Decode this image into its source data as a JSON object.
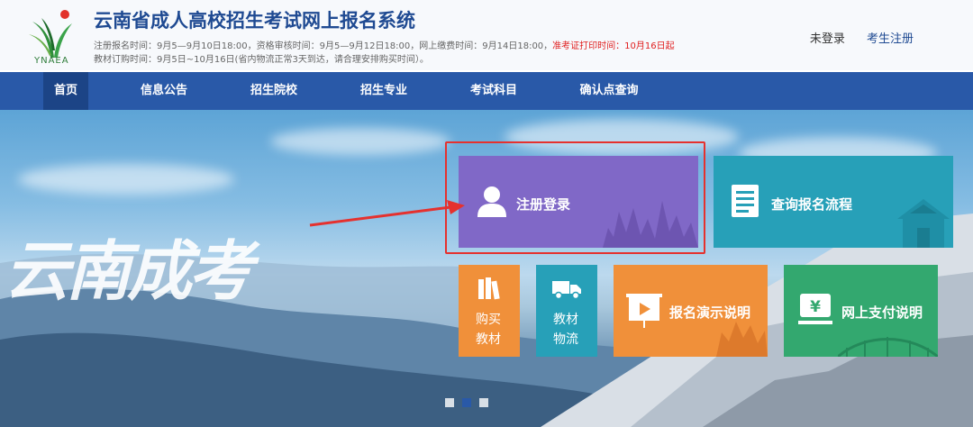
{
  "header": {
    "logo_text": "YNAEA",
    "title": "云南省成人高校招生考试网上报名系统",
    "info_line1_normal": "注册报名时间：9月5—9月10日18:00，资格审核时间：9月5—9月12日18:00，网上缴费时间：9月14日18:00，",
    "info_line1_highlight": "准考证打印时间：10月16日起",
    "info_line2": "教材订购时间：9月5日~10月16日(省内物流正常3天到达，请合理安排购买时间）。",
    "login_status": "未登录",
    "register_link": "考生注册"
  },
  "nav": {
    "items": [
      {
        "label": "首页",
        "active": true
      },
      {
        "label": "信息公告"
      },
      {
        "label": "招生院校"
      },
      {
        "label": "招生专业"
      },
      {
        "label": "考试科目"
      },
      {
        "label": "确认点查询"
      }
    ]
  },
  "hero": {
    "slogan": "云南成考"
  },
  "tiles": {
    "register_login": "注册登录",
    "query_process": "查询报名流程",
    "buy_books_l1": "购买",
    "buy_books_l2": "教材",
    "book_logistics_l1": "教材",
    "book_logistics_l2": "物流",
    "demo_guide": "报名演示说明",
    "payment_guide": "网上支付说明",
    "yen_symbol": "¥"
  },
  "colors": {
    "nav_bg": "#2959a8",
    "nav_active": "#1c4486",
    "title": "#1f4a92",
    "purple_tile": "#8068c7",
    "teal_tile": "#27a0b8",
    "orange_tile": "#f0903a",
    "green_tile": "#33a86f",
    "highlight_red": "#e5312e"
  },
  "carousel": {
    "slide_count": 3,
    "active_slide": 2
  }
}
